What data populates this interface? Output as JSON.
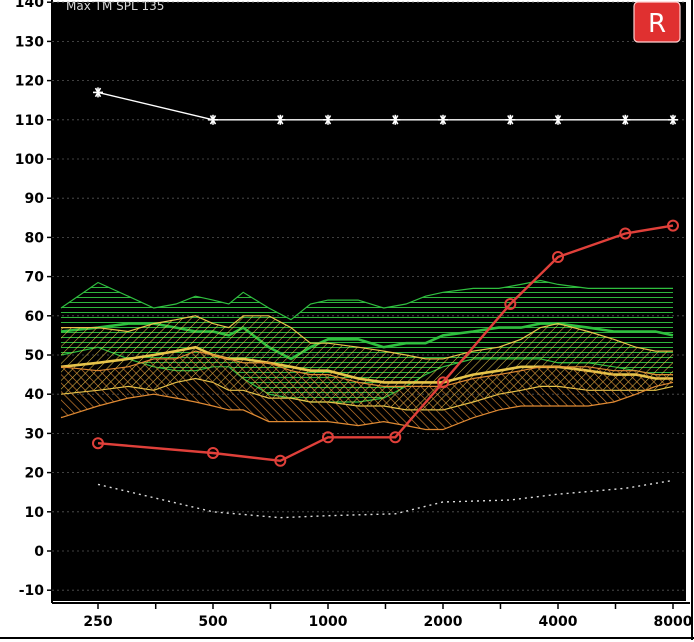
{
  "chart_data": {
    "type": "line",
    "title": "",
    "top_label": "Max TM SPL 135",
    "ear_badge": "R",
    "xlabel": "",
    "ylabel": "",
    "ylim": [
      -10,
      140
    ],
    "y_ticks": [
      -10,
      0,
      10,
      20,
      30,
      40,
      50,
      60,
      70,
      80,
      90,
      100,
      110,
      120,
      130,
      140
    ],
    "x_categories": [
      "250",
      "500",
      "1000",
      "2000",
      "4000",
      "8000"
    ],
    "grid": "horizontal",
    "colors": {
      "background": "#000000",
      "grid": "#555555",
      "threshold": "#e0403a",
      "max_output": "#ffffff",
      "soft_region": "#e08a33",
      "average_region": "#e6c44a",
      "loud_region": "#2fbf3f",
      "badge": "#e03030"
    },
    "series": [
      {
        "role": "max_output_asterisks",
        "x": [
          250,
          500,
          750,
          1000,
          1500,
          2000,
          3000,
          4000,
          6000,
          8000
        ],
        "y": [
          117,
          110,
          110,
          110,
          110,
          110,
          110,
          110,
          110,
          110
        ]
      },
      {
        "role": "threshold_circles",
        "x": [
          250,
          500,
          750,
          1000,
          1500,
          2000,
          3000,
          4000,
          6000,
          8000
        ],
        "y": [
          27.5,
          25,
          23,
          29,
          29,
          43,
          63,
          75,
          81,
          83
        ]
      },
      {
        "role": "dotted_curve",
        "x": [
          250,
          500,
          750,
          1000,
          1500,
          2000,
          3000,
          4000,
          6000,
          8000
        ],
        "y": [
          17,
          10,
          8.5,
          9,
          9.5,
          12.5,
          13,
          14.5,
          16,
          18
        ]
      }
    ],
    "bands": [
      {
        "role": "loud_speech_band",
        "x": [
          200,
          250,
          300,
          350,
          400,
          450,
          500,
          550,
          600,
          700,
          800,
          900,
          1000,
          1200,
          1400,
          1600,
          1800,
          2000,
          2400,
          2800,
          3200,
          3600,
          4000,
          4800,
          5600,
          6400,
          7200,
          8000
        ],
        "upper": [
          62,
          68.5,
          65,
          62,
          63,
          65,
          64,
          63,
          66,
          62,
          59,
          63,
          64,
          64,
          62,
          63,
          65,
          66,
          67,
          67,
          68,
          69,
          68,
          67,
          67,
          67,
          67,
          67
        ],
        "median": [
          56,
          57,
          58,
          58,
          57,
          56,
          56,
          55,
          57,
          52,
          49,
          52,
          54,
          54,
          52,
          53,
          53,
          55,
          56,
          57,
          57,
          58,
          58,
          57,
          56,
          56,
          56,
          55
        ],
        "lower": [
          50,
          52,
          49,
          47,
          46,
          46,
          47,
          47,
          44,
          40,
          39,
          38,
          38,
          38,
          39,
          42,
          45,
          47,
          49,
          49,
          49,
          49,
          48,
          48,
          47,
          46,
          45,
          45
        ]
      },
      {
        "role": "average_speech_band",
        "x": [
          200,
          250,
          300,
          350,
          400,
          450,
          500,
          550,
          600,
          700,
          800,
          900,
          1000,
          1200,
          1400,
          1600,
          1800,
          2000,
          2400,
          2800,
          3200,
          3600,
          4000,
          4800,
          5600,
          6400,
          7200,
          8000
        ],
        "upper": [
          57,
          57,
          56,
          58,
          59,
          60,
          58,
          57,
          60,
          60,
          57,
          53,
          53,
          52,
          51,
          50,
          49,
          49,
          51,
          52,
          54,
          57,
          58,
          56,
          54,
          52,
          51,
          51
        ],
        "median": [
          47,
          48,
          49,
          50,
          51,
          52,
          50,
          49,
          49,
          48,
          47,
          46,
          46,
          44,
          43,
          43,
          43,
          43,
          45,
          46,
          47,
          47,
          47,
          46,
          45,
          45,
          44,
          44
        ],
        "lower": [
          40,
          41,
          42,
          41,
          43,
          44,
          43,
          41,
          41,
          39,
          39,
          38,
          38,
          37,
          37,
          36,
          36,
          36,
          38,
          40,
          41,
          42,
          42,
          41,
          41,
          41,
          41,
          42
        ]
      },
      {
        "role": "soft_speech_band",
        "x": [
          200,
          250,
          300,
          350,
          400,
          450,
          500,
          550,
          600,
          700,
          800,
          900,
          1000,
          1200,
          1400,
          1600,
          1800,
          2000,
          2400,
          2800,
          3200,
          3600,
          4000,
          4800,
          5600,
          6400,
          7200,
          8000
        ],
        "upper": [
          47,
          46,
          47,
          49,
          49,
          51,
          50,
          49,
          48,
          48,
          46,
          45,
          45,
          43,
          42,
          42,
          42,
          42,
          44,
          45,
          46,
          47,
          47,
          47,
          46,
          46,
          45,
          45
        ],
        "lower": [
          34,
          37,
          39,
          40,
          39,
          38,
          37,
          36,
          36,
          33,
          33,
          33,
          33,
          32,
          33,
          32,
          31,
          31,
          34,
          36,
          37,
          37,
          37,
          37,
          38,
          40,
          42,
          43
        ]
      }
    ]
  }
}
